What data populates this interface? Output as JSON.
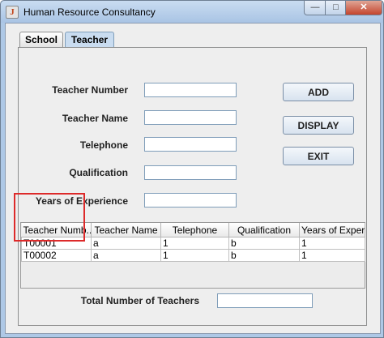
{
  "window": {
    "title": "Human Resource Consultancy",
    "app_icon": "java-icon",
    "controls": {
      "minimize": "—",
      "maximize": "□",
      "close": "✕"
    }
  },
  "tabs": [
    {
      "label": "School",
      "selected": false
    },
    {
      "label": "Teacher",
      "selected": true
    }
  ],
  "form": {
    "teacher_number_label": "Teacher Number",
    "teacher_name_label": "Teacher Name",
    "telephone_label": "Telephone",
    "qualification_label": "Qualification",
    "experience_label": "Years of Experience",
    "teacher_number": "",
    "teacher_name": "",
    "telephone": "",
    "qualification": "",
    "experience": ""
  },
  "buttons": {
    "add": "ADD",
    "display": "DISPLAY",
    "exit": "EXIT"
  },
  "table": {
    "headers": [
      "Teacher Numb...",
      "Teacher Name",
      "Telephone",
      "Qualification",
      "Years of Experi..."
    ],
    "rows": [
      [
        "T00001",
        "a",
        "1",
        "b",
        "1"
      ],
      [
        "T00002",
        "a",
        "1",
        "b",
        "1"
      ]
    ]
  },
  "total": {
    "label": "Total Number of Teachers",
    "value": ""
  },
  "colors": {
    "highlight": "#dd2a2a",
    "title_bar": "#b9d1ea"
  }
}
